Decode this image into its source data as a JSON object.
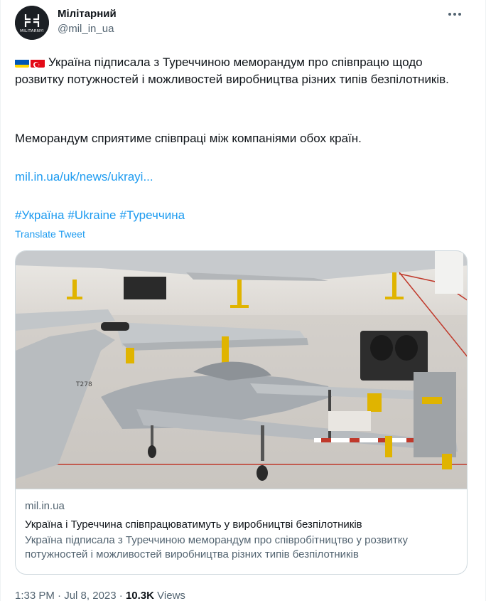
{
  "author": {
    "name": "Мілітарний",
    "handle": "@mil_in_ua",
    "avatar_text": "MILITARNYI",
    "avatar_icon": "militarnyi-logo-icon"
  },
  "more_icon": "more-horizontal-icon",
  "flags": [
    "ukraine-flag-icon",
    "turkey-flag-icon"
  ],
  "tweet": {
    "line1": "Україна підписала з Туреччиною меморандум про співпрацю щодо розвитку потужностей і можливостей виробництва різних типів безпілотників.",
    "line2": "Меморандум сприятиме співпраці між компаніями обох країн.",
    "link": "mil.in.ua/uk/news/ukrayi...",
    "hashtags": [
      "#Україна",
      "#Ukraine",
      "#Туреччина"
    ],
    "translate": "Translate Tweet"
  },
  "card": {
    "domain": "mil.in.ua",
    "title": "Україна і Туреччина співпрацюватимуть у виробництві безпілотників",
    "description": "Україна підписала з Туреччиною меморандум про співробітництво у розвитку потужностей і можливостей виробництва різних типів безпілотників",
    "image_icon": "drone-hangar-photo"
  },
  "meta": {
    "time": "1:33 PM",
    "separator": "·",
    "date": "Jul 8, 2023",
    "views_count": "10.3K",
    "views_label": "Views"
  },
  "colors": {
    "link": "#1d9bf0",
    "text": "#0f1419",
    "secondary": "#536471",
    "border": "#cfd9de"
  }
}
